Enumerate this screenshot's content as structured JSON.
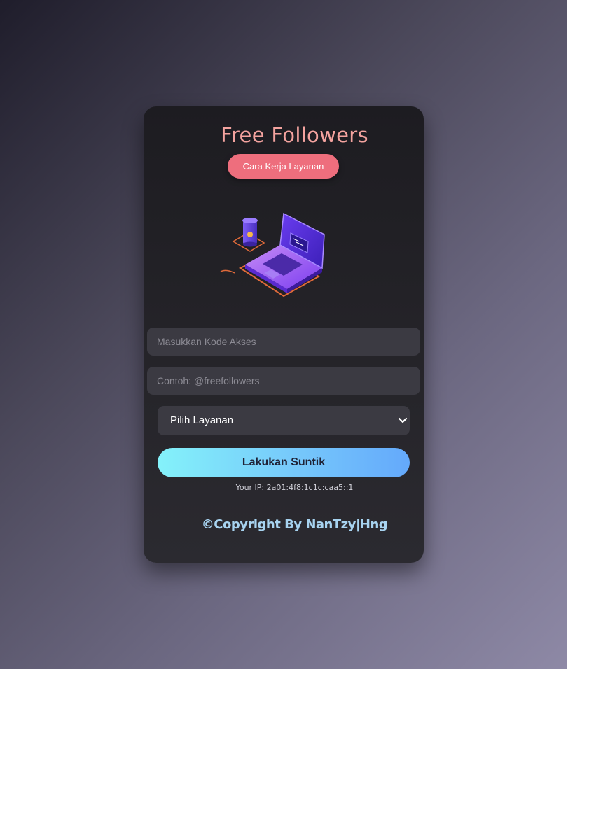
{
  "header": {
    "title": "Free Followers",
    "how_it_works_label": "Cara Kerja Layanan"
  },
  "illustration": {
    "icon": "laptop-coffee-illustration"
  },
  "form": {
    "access_code_placeholder": "Masukkan Kode Akses",
    "username_placeholder": "Contoh: @freefollowers",
    "service_select": {
      "selected": "Pilih Layanan"
    },
    "submit_label": "Lakukan Suntik"
  },
  "footer": {
    "ip_text": "Your IP: 2a01:4f8:1c1c:caa5::1",
    "copyright": "©Copyright By NanTzy|Hng"
  },
  "colors": {
    "title": "#f4a39f",
    "how_button": "#ee6e7d",
    "submit_gradient_start": "#84f2fa",
    "submit_gradient_end": "#64a9fb",
    "copyright": "#a7d3f0",
    "card_bg": "#1d1c21"
  }
}
